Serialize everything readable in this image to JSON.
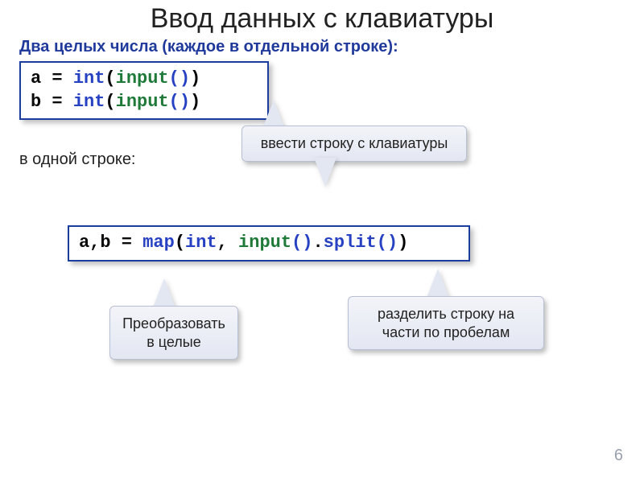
{
  "title": "Ввод данных с клавиатуры",
  "subtitle": "Два целых числа (каждое в отдельной строке):",
  "code1": {
    "a": "a",
    "b": "b",
    "eq": " = ",
    "int": "int",
    "lp": "(",
    "input": "input",
    "paren": "()",
    "rp": ")"
  },
  "note": "в одной строке:",
  "code2": {
    "ab": "a,b",
    "eq": " = ",
    "map": "map",
    "lp": "(",
    "int": "int",
    "comma": ", ",
    "input": "input",
    "paren1": "()",
    "dot": ".",
    "split": "split",
    "paren2": "()",
    "rp": ")"
  },
  "callouts": {
    "c1": "ввести строку с клавиатуры",
    "c2": "Преобразовать в целые",
    "c3": "разделить строку на части по пробелам"
  },
  "page": "6"
}
